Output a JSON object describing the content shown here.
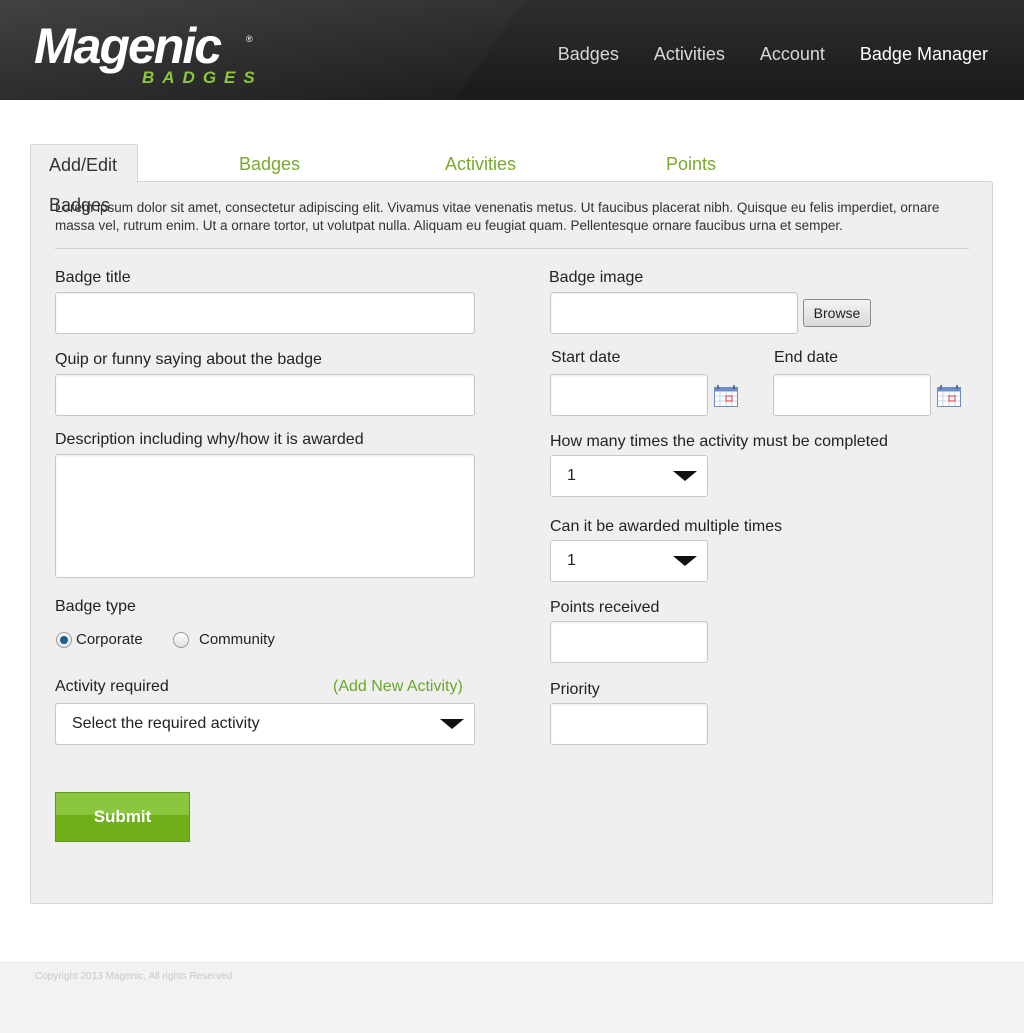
{
  "header": {
    "logo_text": "Magenic",
    "logo_sub": "BADGES",
    "logo_reg": "®",
    "nav": [
      "Badges",
      "Activities",
      "Account",
      "Badge Manager"
    ]
  },
  "tabs": [
    "Add/Edit Badges",
    "Badges for Approval",
    "Activities for Approval",
    "Points Report"
  ],
  "intro": "Lorem ipsum dolor sit amet, consectetur adipiscing elit. Vivamus vitae venenatis metus. Ut faucibus placerat nibh. Quisque eu felis imperdiet, ornare massa vel, rutrum enim. Ut a ornare tortor, ut volutpat nulla. Aliquam eu feugiat quam. Pellentesque ornare faucibus urna et semper.",
  "form": {
    "badge_title_label": "Badge title",
    "quip_label": "Quip or funny saying about the badge",
    "description_label": "Description including why/how it is awarded",
    "badge_type_label": "Badge type",
    "badge_type_options": [
      "Corporate",
      "Community"
    ],
    "badge_type_selected": "Corporate",
    "activity_required_label": "Activity required",
    "add_new_activity_link": "(Add New Activity)",
    "activity_select_value": "Select the required activity",
    "badge_image_label": "Badge image",
    "browse_label": "Browse",
    "start_date_label": "Start date",
    "end_date_label": "End date",
    "times_label": "How many times the activity must be completed",
    "times_value": "1",
    "multiple_label": "Can it be awarded multiple times",
    "multiple_value": "1",
    "points_label": "Points received",
    "priority_label": "Priority",
    "submit_label": "Submit"
  },
  "footer": {
    "copyright": "Copyright 2013 Magenic, All rights Reserved"
  },
  "colors": {
    "accent_green": "#8bc63e",
    "header_dark": "#1f1f1f",
    "panel_bg": "#efefef"
  }
}
